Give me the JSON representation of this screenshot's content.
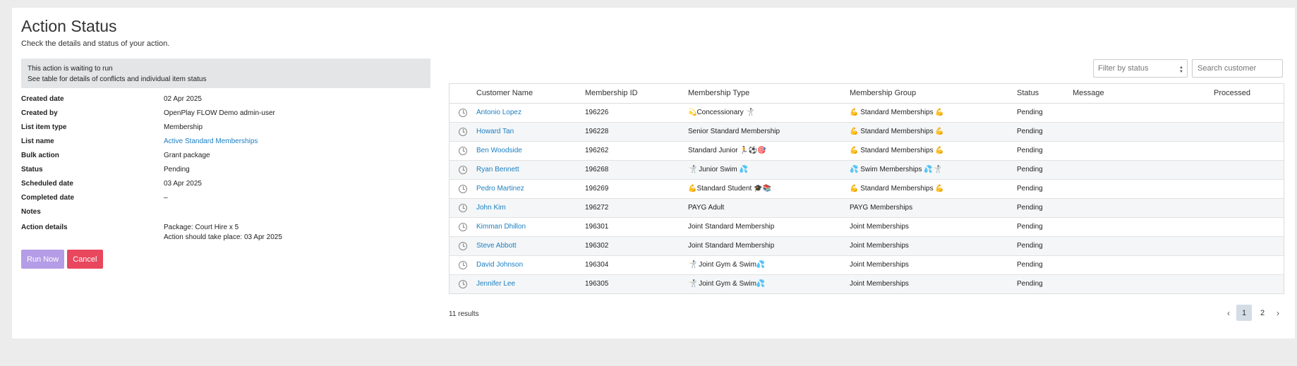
{
  "header": {
    "title": "Action Status",
    "subtitle": "Check the details and status of your action."
  },
  "alert": {
    "line1": "This action is waiting to run",
    "line2": "See table for details of conflicts and individual item status"
  },
  "details": {
    "created_date": {
      "label": "Created date",
      "value": "02 Apr 2025"
    },
    "created_by": {
      "label": "Created by",
      "value": "OpenPlay FLOW Demo admin-user"
    },
    "list_item_type": {
      "label": "List item type",
      "value": "Membership"
    },
    "list_name": {
      "label": "List name",
      "value": "Active Standard Memberships"
    },
    "bulk_action": {
      "label": "Bulk action",
      "value": "Grant package"
    },
    "status": {
      "label": "Status",
      "value": "Pending"
    },
    "scheduled_date": {
      "label": "Scheduled date",
      "value": "03 Apr 2025"
    },
    "completed_date": {
      "label": "Completed date",
      "value": "–"
    },
    "notes": {
      "label": "Notes",
      "value": ""
    },
    "action_details": {
      "label": "Action details",
      "line1": "Package: Court Hire x 5",
      "line2": "Action should take place: 03 Apr 2025"
    }
  },
  "buttons": {
    "run_now": "Run Now",
    "cancel": "Cancel"
  },
  "filters": {
    "status_placeholder": "Filter by status",
    "search_placeholder": "Search customer"
  },
  "table": {
    "columns": [
      "Customer Name",
      "Membership ID",
      "Membership Type",
      "Membership Group",
      "Status",
      "Message",
      "Processed"
    ],
    "rows": [
      {
        "name": "Antonio Lopez",
        "id": "196226",
        "type": "💫Concessionary 🤺",
        "group": "💪 Standard Memberships 💪",
        "status": "Pending",
        "message": "",
        "processed": ""
      },
      {
        "name": "Howard Tan",
        "id": "196228",
        "type": "Senior Standard Membership",
        "group": "💪 Standard Memberships 💪",
        "status": "Pending",
        "message": "",
        "processed": ""
      },
      {
        "name": "Ben Woodside",
        "id": "196262",
        "type": "Standard Junior 🏃⚽🎯",
        "group": "💪 Standard Memberships 💪",
        "status": "Pending",
        "message": "",
        "processed": ""
      },
      {
        "name": "Ryan Bennett",
        "id": "196268",
        "type": "🤺 Junior Swim 💦",
        "group": "💦 Swim Memberships 💦🤺",
        "status": "Pending",
        "message": "",
        "processed": ""
      },
      {
        "name": "Pedro Martinez",
        "id": "196269",
        "type": "💪Standard Student 🎓📚",
        "group": "💪 Standard Memberships 💪",
        "status": "Pending",
        "message": "",
        "processed": ""
      },
      {
        "name": "John Kim",
        "id": "196272",
        "type": "PAYG Adult",
        "group": "PAYG Memberships",
        "status": "Pending",
        "message": "",
        "processed": ""
      },
      {
        "name": "Kimman Dhillon",
        "id": "196301",
        "type": "Joint Standard Membership",
        "group": "Joint Memberships",
        "status": "Pending",
        "message": "",
        "processed": ""
      },
      {
        "name": "Steve Abbott",
        "id": "196302",
        "type": "Joint Standard Membership",
        "group": "Joint Memberships",
        "status": "Pending",
        "message": "",
        "processed": ""
      },
      {
        "name": "David Johnson",
        "id": "196304",
        "type": "🤺 Joint Gym & Swim💦",
        "group": "Joint Memberships",
        "status": "Pending",
        "message": "",
        "processed": ""
      },
      {
        "name": "Jennifer Lee",
        "id": "196305",
        "type": "🤺 Joint Gym & Swim💦",
        "group": "Joint Memberships",
        "status": "Pending",
        "message": "",
        "processed": ""
      }
    ]
  },
  "footer": {
    "results": "11 results",
    "pages": [
      "1",
      "2"
    ],
    "prev": "‹",
    "next": "›"
  }
}
